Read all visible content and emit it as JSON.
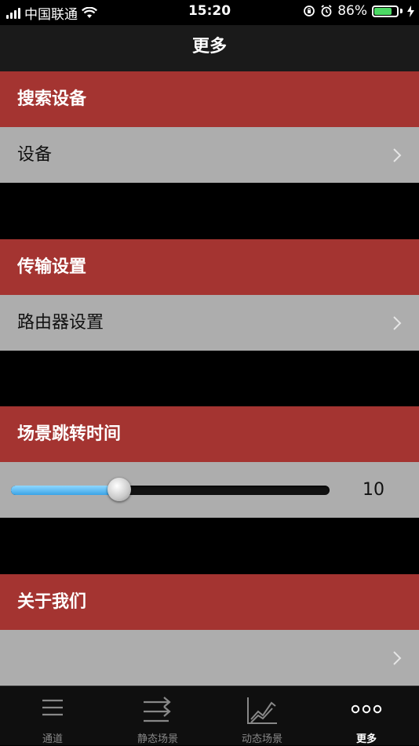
{
  "status_bar": {
    "carrier": "中国联通",
    "time": "15:20",
    "battery_percent": "86%",
    "battery_level": 0.86
  },
  "nav": {
    "title": "更多"
  },
  "sections": [
    {
      "header": "搜索设备",
      "row_label": "设备"
    },
    {
      "header": "传输设置",
      "row_label": "路由器设置"
    },
    {
      "header": "场景跳转时间",
      "slider_value": "10",
      "slider_fraction": 0.34
    },
    {
      "header": "关于我们",
      "row_label": ""
    }
  ],
  "tabs": [
    {
      "label": "通道",
      "icon": "menu-icon"
    },
    {
      "label": "静态场景",
      "icon": "transfer-arrows-icon"
    },
    {
      "label": "动态场景",
      "icon": "line-chart-icon"
    },
    {
      "label": "更多",
      "icon": "more-dots-icon",
      "active": true
    }
  ],
  "colors": {
    "header_red": "#a43431",
    "row_gray": "#adadad",
    "battery_green": "#4cd964",
    "slider_blue": "#3aa3e6"
  }
}
